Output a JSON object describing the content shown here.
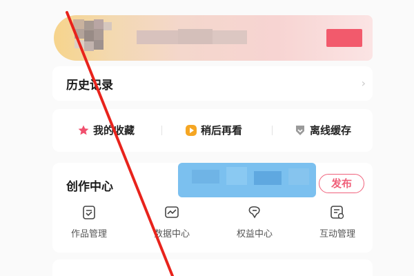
{
  "history": {
    "title": "历史记录",
    "arrow": "›"
  },
  "shortcuts": [
    {
      "label": "我的收藏",
      "icon": "star-icon",
      "color": "#f0506e"
    },
    {
      "label": "稍后再看",
      "icon": "play-icon",
      "color": "#f5a623"
    },
    {
      "label": "离线缓存",
      "icon": "download-icon",
      "color": "#8a8a8a"
    }
  ],
  "creator": {
    "title": "创作中心",
    "publish_label": "发布",
    "tools": [
      {
        "label": "作品管理",
        "icon": "works-icon"
      },
      {
        "label": "数据中心",
        "icon": "chart-icon"
      },
      {
        "label": "权益中心",
        "icon": "rights-icon"
      },
      {
        "label": "互动管理",
        "icon": "interaction-icon"
      }
    ]
  },
  "colors": {
    "accent": "#f0607a",
    "annotation": "#e8231c"
  }
}
